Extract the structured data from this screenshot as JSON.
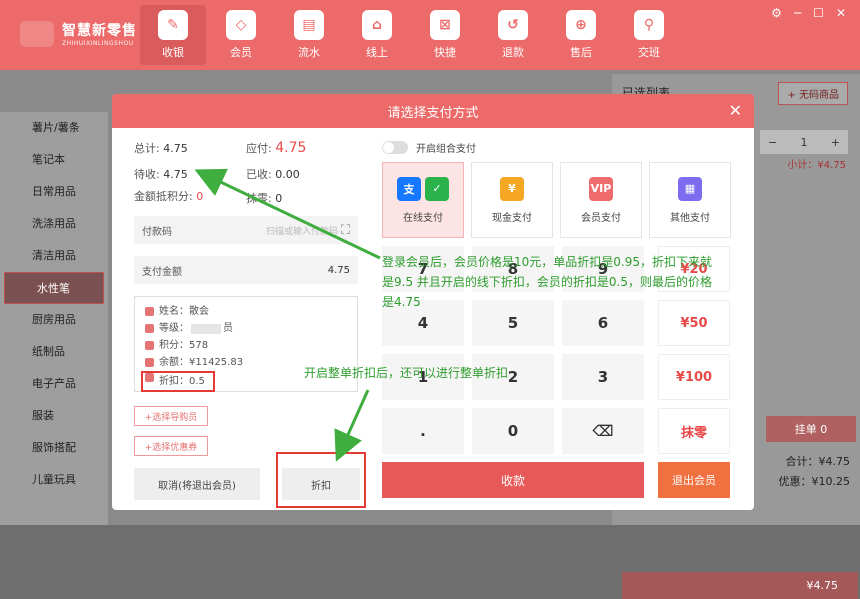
{
  "app": {
    "name": "智慧新零售",
    "sub": "ZHIHUIXINLINGSHOU"
  },
  "nav": [
    {
      "label": "收银",
      "icon": "✎",
      "active": true
    },
    {
      "label": "会员",
      "icon": "◇"
    },
    {
      "label": "流水",
      "icon": "▤"
    },
    {
      "label": "线上",
      "icon": "⌂"
    },
    {
      "label": "快捷",
      "icon": "⊠"
    },
    {
      "label": "退款",
      "icon": "↺"
    },
    {
      "label": "售后",
      "icon": "⊕"
    },
    {
      "label": "交班",
      "icon": "⚲"
    }
  ],
  "winctl": {
    "settings": "⚙",
    "min": "─",
    "max": "☐",
    "close": "✕"
  },
  "categories": [
    "薯片/薯条",
    "笔记本",
    "日常用品",
    "洗涤用品",
    "清洁用品",
    "水性笔",
    "厨房用品",
    "纸制品",
    "电子产品",
    "服装",
    "服饰搭配",
    "儿童玩具"
  ],
  "active_category": "水性笔",
  "right": {
    "title": "已选列表",
    "no_code": "+ 无码商品",
    "qty": "1",
    "subtotal": "小计：¥4.75",
    "hang": "挂单",
    "hang_count": "0",
    "total": "合计：¥4.75",
    "discount": "优惠：¥10.25",
    "pay": "¥4.75"
  },
  "modal": {
    "title": "请选择支付方式",
    "close": "✕",
    "total_label": "总计:",
    "total": "4.75",
    "due_label": "应付:",
    "due": "4.75",
    "pending_label": "待收:",
    "pending": "4.75",
    "received_label": "已收:",
    "received": "0.00",
    "points_label": "金额抵积分:",
    "points": "0",
    "round_label": "抹零:",
    "round": "0",
    "paycode_label": "付款码",
    "paycode_placeholder": "扫描或输入付款码",
    "amount_label": "支付金额",
    "amount": "4.75",
    "member": {
      "name": "姓名：散会",
      "level": "等级：",
      "level_tail": "员",
      "points": "积分：578",
      "balance": "余额：¥11425.83",
      "discount": "折扣：0.5"
    },
    "choose_guide": "+选择导购员",
    "choose_coupon": "+选择优惠券",
    "cancel": "取消(将退出会员)",
    "discount_btn": "折扣",
    "combo_label": "开启组合支付",
    "methods": [
      {
        "label": "在线支付",
        "icons": [
          "支",
          "✓"
        ],
        "colors": [
          "#1677ff",
          "#2bb34b"
        ],
        "active": true
      },
      {
        "label": "现金支付",
        "icons": [
          "¥"
        ],
        "colors": [
          "#f5a623"
        ]
      },
      {
        "label": "会员支付",
        "icons": [
          "VIP"
        ],
        "colors": [
          "#ef6c6c"
        ]
      },
      {
        "label": "其他支付",
        "icons": [
          "▦"
        ],
        "colors": [
          "#7e6cf0"
        ]
      }
    ],
    "keys": [
      "7",
      "8",
      "9",
      "4",
      "5",
      "6",
      "1",
      "2",
      "3",
      ".",
      "0",
      "⌫"
    ],
    "quick": [
      "¥20",
      "¥50",
      "¥100",
      "抹零"
    ],
    "pay": "收款",
    "exit_member": "退出会员"
  },
  "annotations": {
    "note1": "登录会员后，会员价格是10元，单品折扣是0.95，折扣下来就是9.5  并且开启的线下折扣，会员的折扣是0.5，则最后的价格是4.75",
    "note2": "开启整单折扣后，还可以进行整单折扣"
  }
}
